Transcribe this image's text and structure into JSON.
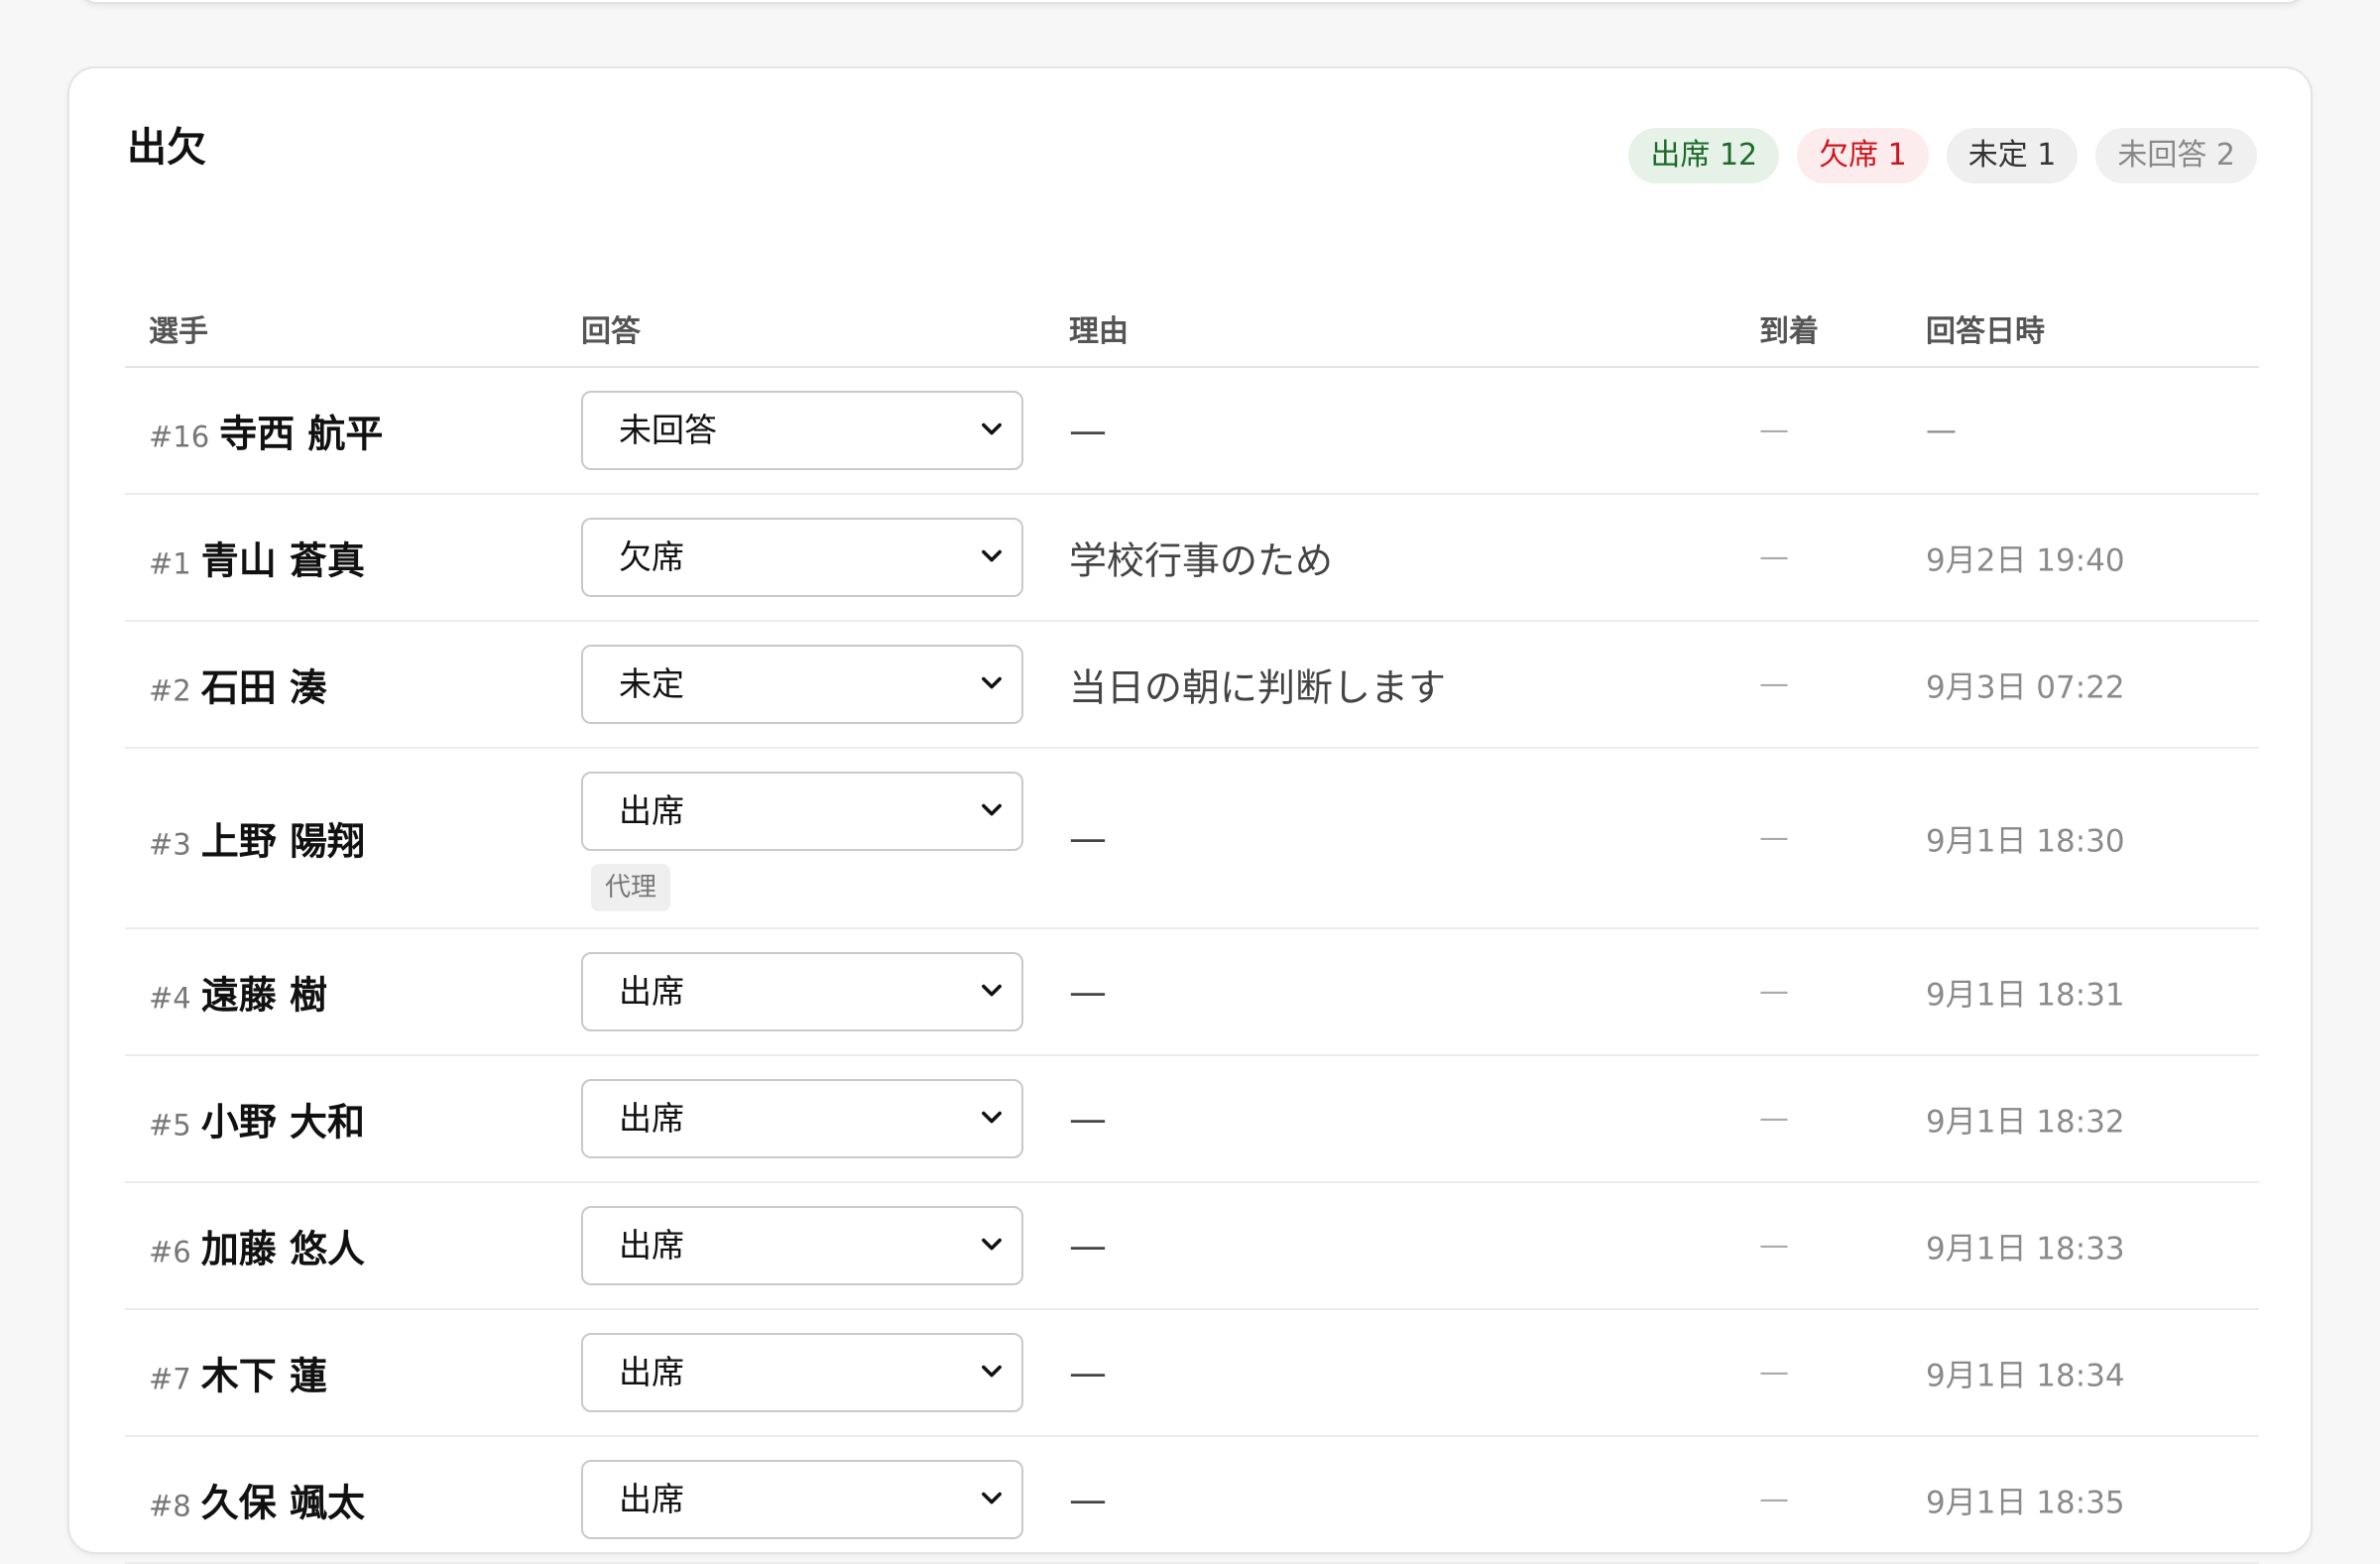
{
  "section_title": "出欠",
  "summary": {
    "attend": "出席 12",
    "absent": "欠席 1",
    "undecided": "未定 1",
    "no_answer": "未回答 2"
  },
  "columns": {
    "player": "選手",
    "answer": "回答",
    "reason": "理由",
    "arrival": "到着",
    "answered_at": "回答日時"
  },
  "rows": [
    {
      "number": "#16",
      "name": "寺西 航平",
      "answer": "未回答",
      "reason": "—",
      "arrival": "—",
      "answered_at": "—"
    },
    {
      "number": "#1",
      "name": "青山 蒼真",
      "answer": "欠席",
      "reason": "学校行事のため",
      "arrival": "—",
      "answered_at": "9月2日 19:40"
    },
    {
      "number": "#2",
      "name": "石田 湊",
      "answer": "未定",
      "reason": "当日の朝に判断します",
      "arrival": "—",
      "answered_at": "9月3日 07:22"
    },
    {
      "number": "#3",
      "name": "上野 陽翔",
      "answer": "出席",
      "proxy": "代理",
      "reason": "—",
      "arrival": "—",
      "answered_at": "9月1日 18:30"
    },
    {
      "number": "#4",
      "name": "遠藤 樹",
      "answer": "出席",
      "reason": "—",
      "arrival": "—",
      "answered_at": "9月1日 18:31"
    },
    {
      "number": "#5",
      "name": "小野 大和",
      "answer": "出席",
      "reason": "—",
      "arrival": "—",
      "answered_at": "9月1日 18:32"
    },
    {
      "number": "#6",
      "name": "加藤 悠人",
      "answer": "出席",
      "reason": "—",
      "arrival": "—",
      "answered_at": "9月1日 18:33"
    },
    {
      "number": "#7",
      "name": "木下 蓮",
      "answer": "出席",
      "reason": "—",
      "arrival": "—",
      "answered_at": "9月1日 18:34"
    },
    {
      "number": "#8",
      "name": "久保 颯太",
      "answer": "出席",
      "reason": "—",
      "arrival": "—",
      "answered_at": "9月1日 18:35"
    }
  ]
}
